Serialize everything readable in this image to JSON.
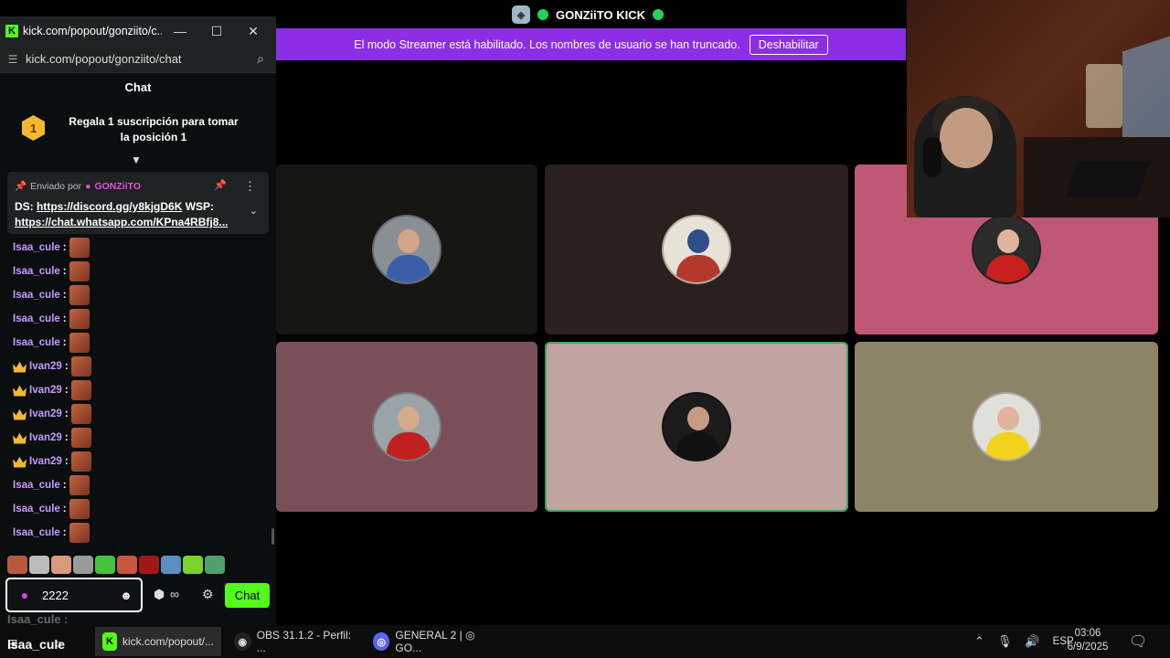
{
  "discord": {
    "server_name": "GONZiiTO KICK",
    "banner_text": "El modo Streamer está habilitado. Los nombres de usuario se han truncado.",
    "banner_button": "Deshabilitar",
    "colors": {
      "banner": "#8b2ee6",
      "speaking": "#3ba55c"
    }
  },
  "kick": {
    "window_title": "kick.com/popout/gonziito/c...",
    "address": "kick.com/popout/gonziito/chat",
    "chat_header": "Chat",
    "gift_rank": "1",
    "gift_text": "Regala 1 suscripción para tomar la posición 1",
    "pinned": {
      "sent_by": "Enviado por",
      "author": "GONZiiTO",
      "ds_label": "DS:",
      "ds_link": "https://discord.gg/y8kjgD6K",
      "wsp_label": "WSP:",
      "wsp_link": "https://chat.whatsapp.com/KPna4RBfj8..."
    },
    "messages": [
      {
        "user": "Isaa_cule",
        "sub": false
      },
      {
        "user": "Isaa_cule",
        "sub": false
      },
      {
        "user": "Isaa_cule",
        "sub": false
      },
      {
        "user": "Isaa_cule",
        "sub": false
      },
      {
        "user": "Isaa_cule",
        "sub": false
      },
      {
        "user": "Ivan29",
        "sub": true
      },
      {
        "user": "Ivan29",
        "sub": true
      },
      {
        "user": "Ivan29",
        "sub": true
      },
      {
        "user": "Ivan29",
        "sub": true
      },
      {
        "user": "Ivan29",
        "sub": true
      },
      {
        "user": "Isaa_cule",
        "sub": false
      },
      {
        "user": "Isaa_cule",
        "sub": false
      },
      {
        "user": "Isaa_cule",
        "sub": false
      }
    ],
    "input_value": "2222",
    "send_label": "Chat",
    "ghost_text": "Isaa_cule :",
    "accent": "#53fc18"
  },
  "taskbar": {
    "overlay_user": "Isaa_cule",
    "apps": [
      {
        "label": "kick.com/popout/...",
        "active": true
      },
      {
        "label": "OBS 31.1.2 - Perfil: ...",
        "active": false
      },
      {
        "label": "GENERAL 2 | ◎ GO...",
        "active": false
      }
    ],
    "language": "ESP",
    "time": "03:06",
    "date": "6/9/2025"
  }
}
